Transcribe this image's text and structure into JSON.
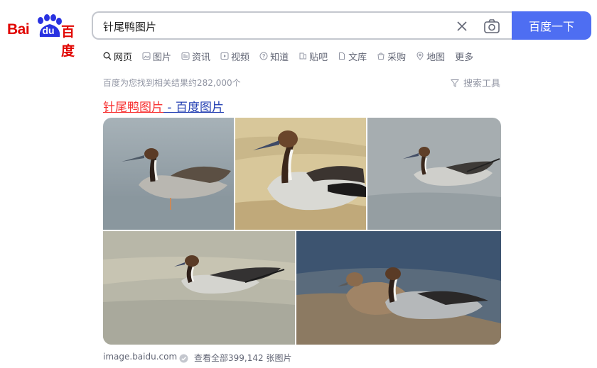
{
  "logo": {
    "part1": "Bai",
    "part2": "du",
    "part3": "百度"
  },
  "search": {
    "value": "针尾鸭图片",
    "button_label": "百度一下"
  },
  "tabs": [
    {
      "label": "网页",
      "icon": "search-icon"
    },
    {
      "label": "图片",
      "icon": "image-icon"
    },
    {
      "label": "资讯",
      "icon": "news-icon"
    },
    {
      "label": "视频",
      "icon": "video-icon"
    },
    {
      "label": "知道",
      "icon": "question-icon"
    },
    {
      "label": "贴吧",
      "icon": "tieba-icon"
    },
    {
      "label": "文库",
      "icon": "doc-icon"
    },
    {
      "label": "采购",
      "icon": "shopping-icon"
    },
    {
      "label": "地图",
      "icon": "map-icon"
    },
    {
      "label": "更多",
      "icon": ""
    }
  ],
  "results": {
    "count_text": "百度为您找到相关结果约282,000个",
    "tools_label": "搜索工具"
  },
  "result": {
    "title_highlight": "针尾鸭图片",
    "title_rest": " - 百度图片",
    "source": "image.baidu.com",
    "view_all": "查看全部399,142 张图片"
  },
  "colors": {
    "brand_blue": "#4e6ef2",
    "brand_red": "#e10602",
    "highlight_red": "#f73131",
    "link_blue": "#2440b3"
  }
}
